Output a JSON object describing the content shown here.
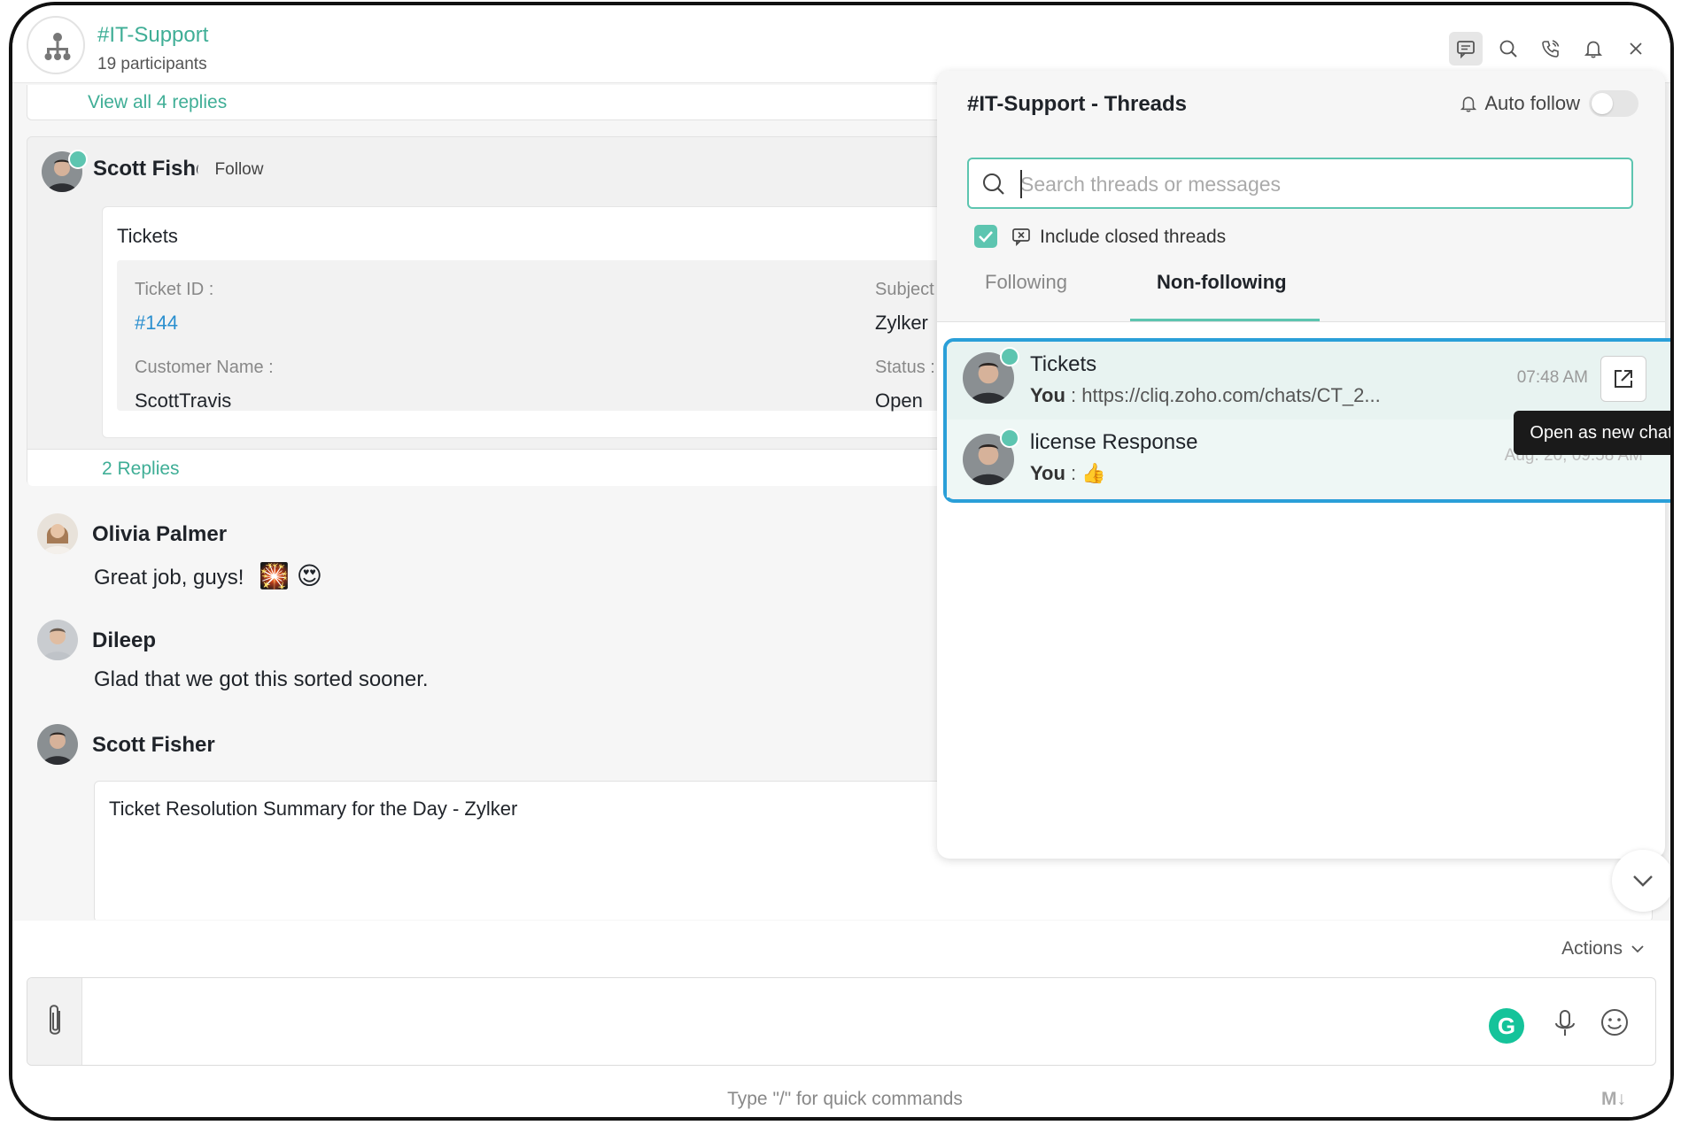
{
  "header": {
    "channel_name": "#IT-Support",
    "participants": "19 participants"
  },
  "messages": {
    "view_all_replies": "View all 4 replies",
    "thread_card": {
      "author": "Scott Fisher",
      "follow_label": "Follow",
      "card_title": "Tickets",
      "ticket_id_label": "Ticket ID :",
      "ticket_id_value": "#144",
      "subject_label": "Subject",
      "subject_value": "Zylker",
      "customer_label": "Customer Name :",
      "customer_value": "ScottTravis",
      "status_label": "Status :",
      "status_value": "Open",
      "replies": "2 Replies"
    },
    "olivia": {
      "author": "Olivia Palmer",
      "text": "Great job, guys!",
      "emojis": "🎇 😍"
    },
    "dileep": {
      "author": "Dileep",
      "text": "Glad that we got this sorted sooner."
    },
    "scott2": {
      "author": "Scott Fisher",
      "text": "Ticket Resolution Summary for the Day - Zylker"
    }
  },
  "threads_panel": {
    "title": "#IT-Support - Threads",
    "auto_follow": "Auto follow",
    "search_placeholder": "Search threads or messages",
    "include_closed": "Include closed threads",
    "tabs": [
      {
        "label": "Following"
      },
      {
        "label": "Non-following"
      }
    ],
    "items": [
      {
        "title": "Tickets",
        "you": "You",
        "preview": " : https://cliq.zoho.com/chats/CT_2...",
        "time": "07:48 AM"
      },
      {
        "title": "license Response",
        "you": "You",
        "preview": " :  👍",
        "time": "Aug. 20, 09:58 AM"
      }
    ],
    "tooltip": "Open as new chat"
  },
  "composer": {
    "actions": "Actions",
    "hint": "Type \"/\" for quick commands",
    "markdown": "M↓",
    "grammarly": "G"
  },
  "colors": {
    "accent": "#3fae96",
    "highlight_border": "#2a9fd8"
  }
}
